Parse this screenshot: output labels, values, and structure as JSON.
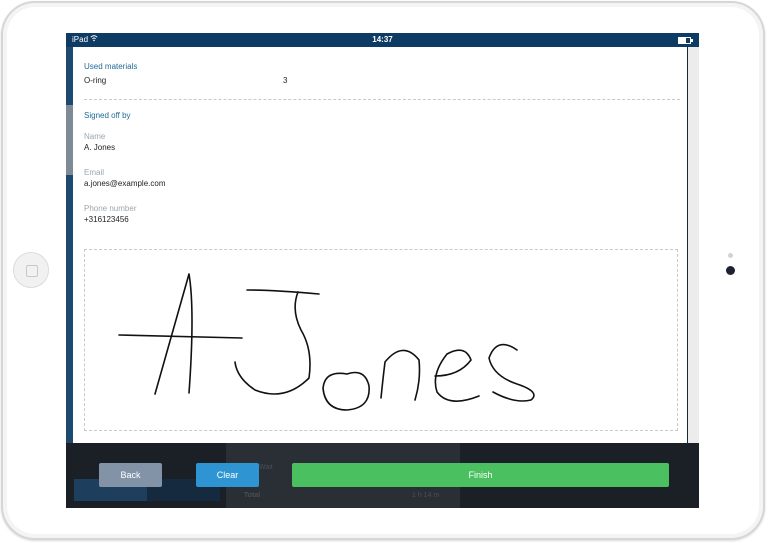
{
  "statusbar": {
    "carrier": "iPad",
    "time": "14:37"
  },
  "materials": {
    "title": "Used materials",
    "items": [
      {
        "name": "O-ring",
        "qty": "3"
      }
    ]
  },
  "signoff": {
    "title": "Signed off by",
    "name_label": "Name",
    "name_value": "A. Jones",
    "email_label": "Email",
    "email_value": "a.jones@example.com",
    "phone_label": "Phone number",
    "phone_value": "+316123456"
  },
  "signature": {
    "icon": "handwritten-signature"
  },
  "background": {
    "wait_label": "Wait",
    "total_label": "Total",
    "total_value": "1 h 14 m"
  },
  "actions": {
    "back_label": "Back",
    "clear_label": "Clear",
    "finish_label": "Finish"
  },
  "colors": {
    "statusbar": "#0e3b63",
    "section_title": "#1e6b96",
    "back": "#8293a8",
    "clear": "#2e95d2",
    "finish": "#4ac060"
  }
}
